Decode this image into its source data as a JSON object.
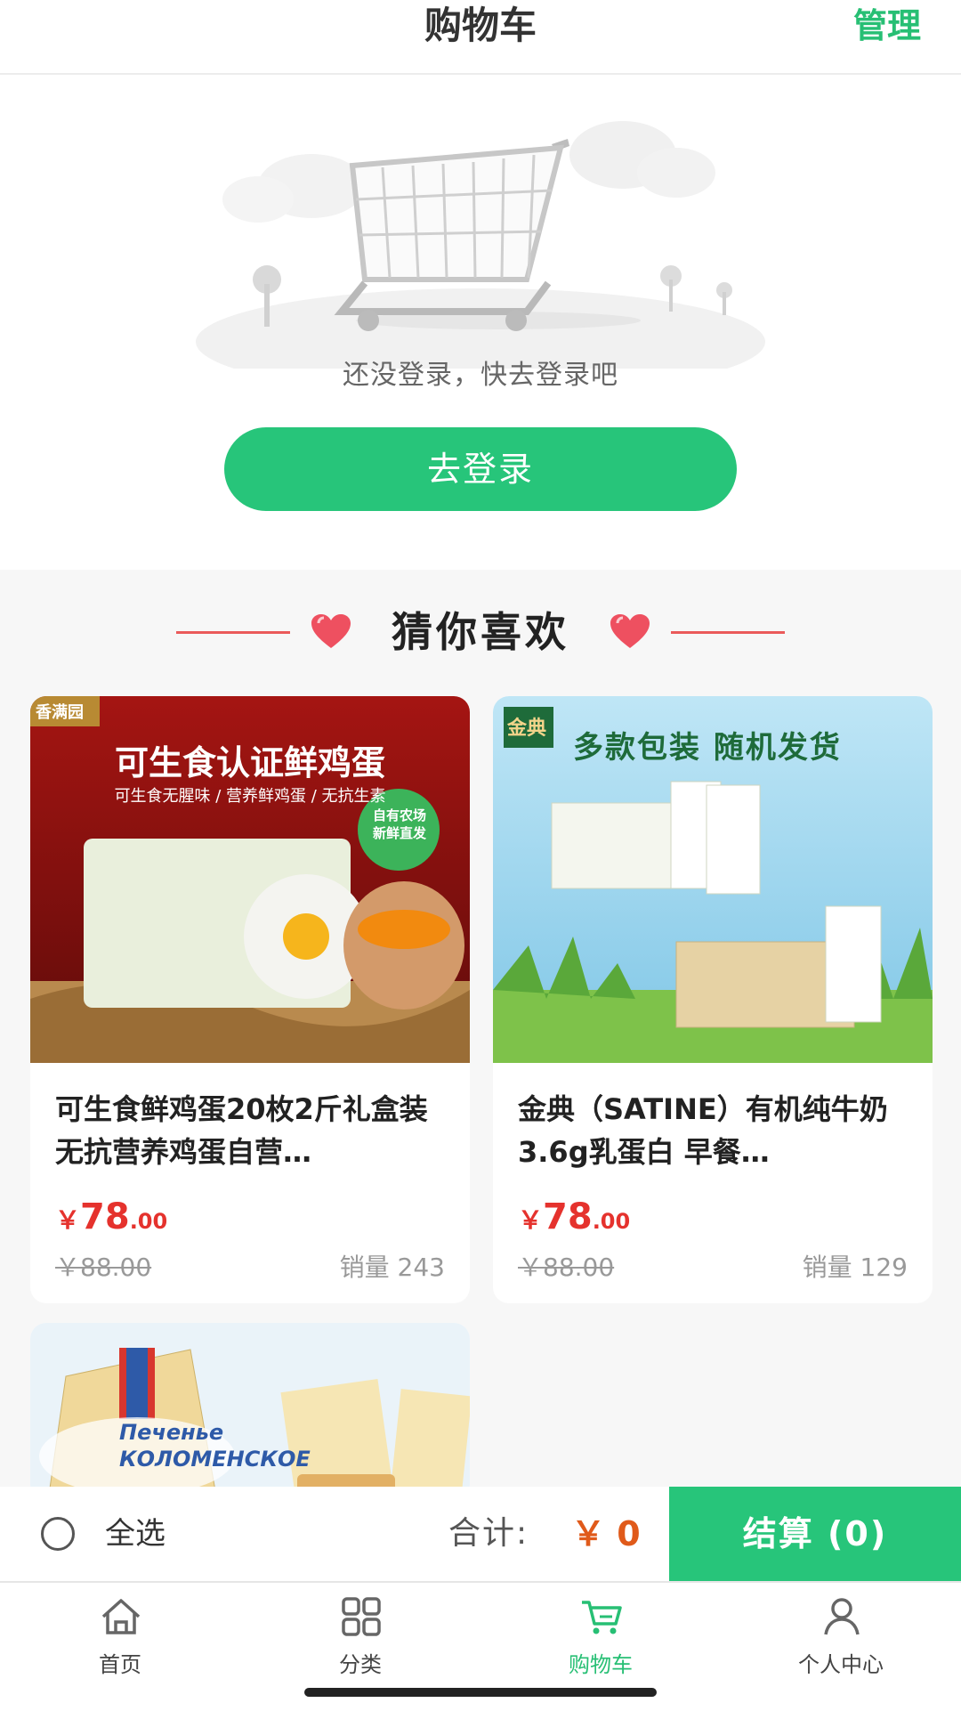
{
  "header": {
    "title": "购物车",
    "manage_label": "管理"
  },
  "empty_state": {
    "message": "还没登录，快去登录吧",
    "login_button": "去登录"
  },
  "recommend": {
    "title": "猜你喜欢",
    "products": [
      {
        "image_banner": "可生食认证鲜鸡蛋",
        "image_sub": "可生食无腥味 / 营养鲜鸡蛋 / 无抗生素",
        "image_brand": "香满园",
        "image_badge": "自有农场 新鲜直发",
        "name": "可生食鲜鸡蛋20枚2斤礼盒装无抗营养鸡蛋自营…",
        "price_symbol": "￥",
        "price_int": "78",
        "price_dec": ".00",
        "original_price": "￥88.00",
        "sales": "销量 243"
      },
      {
        "image_banner": "多款包装 随机发货",
        "image_brand": "金典",
        "name": "金典（SATINE）有机纯牛奶 3.6g乳蛋白 早餐…",
        "price_symbol": "￥",
        "price_int": "78",
        "price_dec": ".00",
        "original_price": "￥88.00",
        "sales": "销量 129"
      },
      {
        "image_text": "Печенье КОЛОМЕНСКОЕ"
      }
    ]
  },
  "checkout": {
    "select_all": "全选",
    "total_label": "合计:",
    "total_value": "￥ 0",
    "checkout_button": "结算 (0)"
  },
  "tabbar": [
    {
      "label": "首页",
      "icon": "home-icon",
      "active": false
    },
    {
      "label": "分类",
      "icon": "category-icon",
      "active": false
    },
    {
      "label": "购物车",
      "icon": "cart-icon",
      "active": true
    },
    {
      "label": "个人中心",
      "icon": "user-icon",
      "active": false
    }
  ],
  "colors": {
    "accent": "#27c57a",
    "price": "#e5322d",
    "total": "#e05a1a"
  }
}
